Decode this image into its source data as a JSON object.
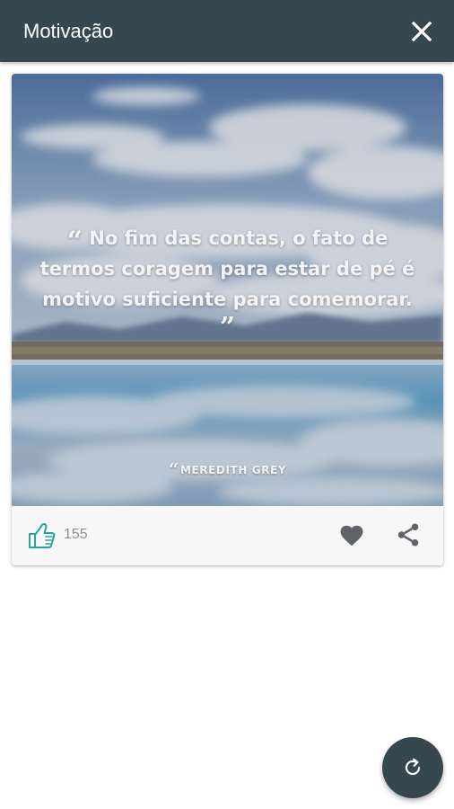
{
  "appbar": {
    "title": "Motivação",
    "close_icon": "close-icon"
  },
  "post": {
    "quote_open": "“",
    "quote_text": "No fim das contas, o fato de termos coragem para estar de pé é motivo suficiente para comemorar.",
    "quote_close": "”",
    "author_mark": "“",
    "author": "MEREDITH GREY",
    "likes": "155",
    "icons": {
      "like": "thumbs-up-icon",
      "favorite": "heart-icon",
      "share": "share-icon"
    }
  },
  "fab": {
    "icon": "refresh-icon"
  },
  "colors": {
    "appbar": "#37474f",
    "like_accent": "#26a69a",
    "icon_gray": "#5f6368",
    "count_gray": "#8a8f93",
    "card_footer": "#f7f7f8"
  }
}
